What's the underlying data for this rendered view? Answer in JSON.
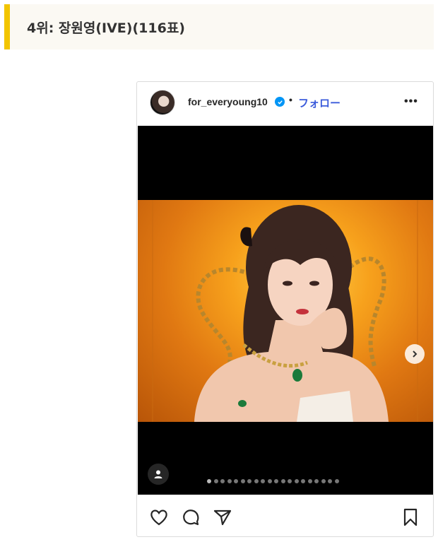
{
  "article": {
    "heading": "4위: 장원영(IVE)(116표)"
  },
  "post": {
    "username": "for_everyoung10",
    "separator": "•",
    "follow_label": "フォロー",
    "more_label": "•••",
    "carousel_count": 20,
    "carousel_active_index": 0
  },
  "icons": {
    "verified": "verified-badge-icon",
    "next": "chevron-right-icon",
    "tag": "user-tag-icon",
    "like": "heart-icon",
    "comment": "comment-icon",
    "share": "paper-plane-icon",
    "save": "bookmark-icon"
  },
  "colors": {
    "accent_bar": "#f2c500",
    "follow_link": "#3b5bdb",
    "verified": "#0095f6"
  }
}
